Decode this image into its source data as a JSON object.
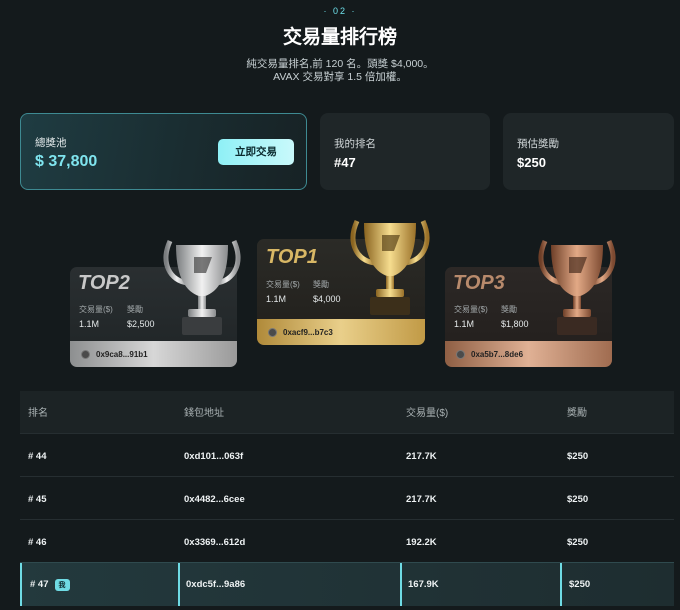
{
  "header": {
    "section_no": "· 02 ·",
    "title": "交易量排行榜",
    "subtitle_line1": "純交易量排名,前 120 名。頭獎 $4,000。",
    "subtitle_line2": "AVAX 交易對享 1.5 倍加權。"
  },
  "stats": {
    "pool_label": "總獎池",
    "pool_value": "$ 37,800",
    "trade_button": "立即交易",
    "my_rank_label": "我的排名",
    "my_rank_value": "#47",
    "est_reward_label": "預估獎勵",
    "est_reward_value": "$250"
  },
  "podium": [
    {
      "rank": "TOP2",
      "volume_label": "交易量($)",
      "volume": "1.1M",
      "reward_label": "獎勵",
      "reward": "$2,500",
      "address": "0x9ca8...91b1"
    },
    {
      "rank": "TOP1",
      "volume_label": "交易量($)",
      "volume": "1.1M",
      "reward_label": "獎勵",
      "reward": "$4,000",
      "address": "0xacf9...b7c3"
    },
    {
      "rank": "TOP3",
      "volume_label": "交易量($)",
      "volume": "1.1M",
      "reward_label": "獎勵",
      "reward": "$1,800",
      "address": "0xa5b7...8de6"
    }
  ],
  "table": {
    "headers": [
      "排名",
      "錢包地址",
      "交易量($)",
      "獎勵"
    ],
    "rows": [
      {
        "rank": "# 44",
        "wallet": "0xd101...063f",
        "volume": "217.7K",
        "reward": "$250"
      },
      {
        "rank": "# 45",
        "wallet": "0x4482...6cee",
        "volume": "217.7K",
        "reward": "$250"
      },
      {
        "rank": "# 46",
        "wallet": "0x3369...612d",
        "volume": "192.2K",
        "reward": "$250"
      },
      {
        "rank": "# 47",
        "wallet": "0xdc5f...9a86",
        "volume": "167.9K",
        "reward": "$250",
        "badge": "我"
      }
    ]
  },
  "colors": {
    "accent": "#6fdbe4",
    "gold": "#c9a24a",
    "silver": "#bdbdbd",
    "bronze": "#b98260"
  }
}
